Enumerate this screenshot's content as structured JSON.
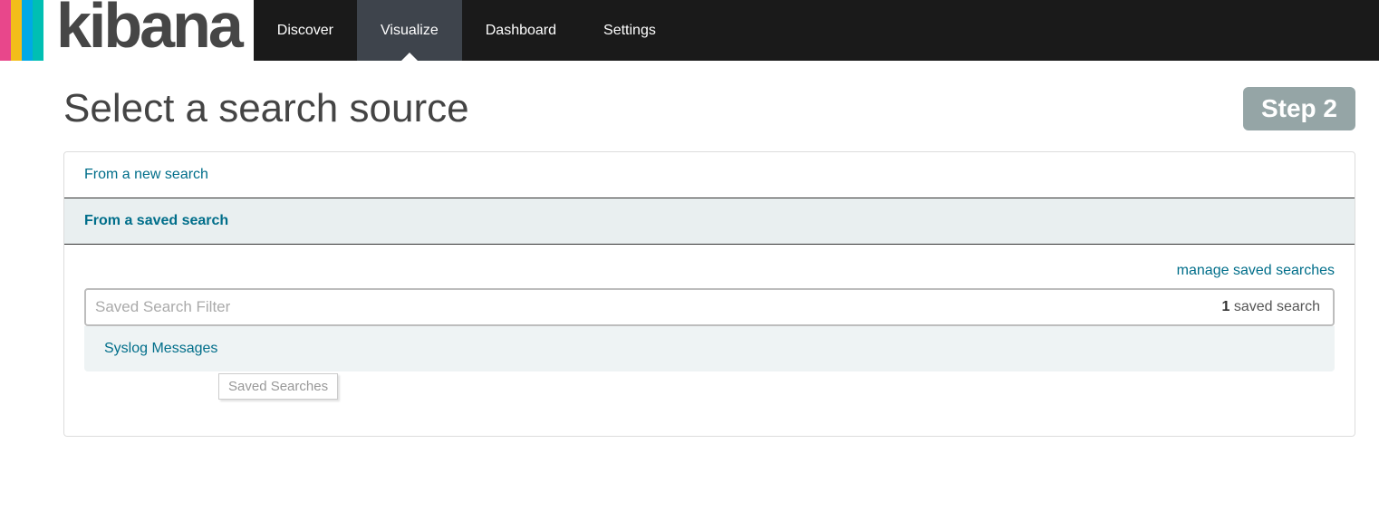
{
  "nav": {
    "logo_text": "kibana",
    "items": [
      {
        "label": "Discover",
        "active": false
      },
      {
        "label": "Visualize",
        "active": true
      },
      {
        "label": "Dashboard",
        "active": false
      },
      {
        "label": "Settings",
        "active": false
      }
    ]
  },
  "page": {
    "title": "Select a search source",
    "step_label": "Step 2"
  },
  "sources": {
    "new_search": "From a new search",
    "saved_search": "From a saved search"
  },
  "saved": {
    "manage_link": "manage saved searches",
    "filter_placeholder": "Saved Search Filter",
    "count_number": "1",
    "count_label": " saved search",
    "results": [
      "Syslog Messages"
    ],
    "tooltip": "Saved Searches"
  }
}
